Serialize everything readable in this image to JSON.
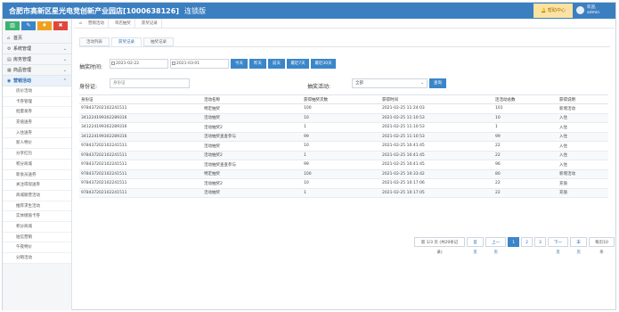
{
  "header": {
    "title": "合肥市高新区星光电竞创新产业园店[1000638126]",
    "version": "连锁版",
    "help_label": "帮助中心",
    "user_line1": "欢迎,",
    "user_line2": "admin"
  },
  "sidebar": {
    "tools": [
      {
        "icon": "bar-chart-icon",
        "glyph": "▥",
        "color": "#3cb371"
      },
      {
        "icon": "edit-icon",
        "glyph": "✎",
        "color": "#3b86c9"
      },
      {
        "icon": "shirt-icon",
        "glyph": "♦",
        "color": "#f0a020"
      },
      {
        "icon": "settings-icon",
        "glyph": "✖",
        "color": "#e0463c"
      }
    ],
    "sections": [
      {
        "label": "首页",
        "icon": "home-icon",
        "glyph": "⌂"
      },
      {
        "label": "系统管理",
        "icon": "gear-icon",
        "glyph": "⚙"
      },
      {
        "label": "房务管理",
        "icon": "bed-icon",
        "glyph": "▤"
      },
      {
        "label": "商品管理",
        "icon": "box-icon",
        "glyph": "▦"
      },
      {
        "label": "营销活动",
        "icon": "marketing-icon",
        "glyph": "◉"
      }
    ],
    "sub_items": [
      "房价活动",
      "卡券管理",
      "批量发券",
      "充值送券",
      "入住送券",
      "新人特价",
      "分享红包",
      "积分商城",
      "新会员送券",
      "关注得现送券",
      "商城联营活动",
      "推荐求生活动",
      "实体储值卡券",
      "积分商城",
      "短信营销",
      "午夜特价",
      "分销活动"
    ]
  },
  "breadcrumb": {
    "items": [
      "营销活动",
      "单店抽奖",
      "获奖记录"
    ]
  },
  "tabs": [
    "活动列表",
    "获奖记录",
    "抽奖记录"
  ],
  "filters": {
    "time_label": "抽奖时间:",
    "date_start": "2021-02-22",
    "date_end": "2021-03-01",
    "quick_buttons": [
      "今天",
      "昨天",
      "前天",
      "最近7天",
      "最近30天"
    ],
    "id_label": "身份证:",
    "id_placeholder": "身份证",
    "activity_label": "抽奖活动:",
    "activity_value": "全部",
    "search_label": "查询"
  },
  "table": {
    "headers": [
      "身份证",
      "活动名称",
      "获得抽奖次数",
      "获得时间",
      "连活动总数",
      "获得说明"
    ],
    "rows": [
      [
        "978437202102241511",
        "特定抽奖",
        "100",
        "2021-02-25 11:24:03",
        "101",
        "新增活动"
      ],
      [
        "341224199302289316",
        "活动抽奖",
        "10",
        "2021-02-25 11:10:53",
        "10",
        "入住"
      ],
      [
        "341224199302289316",
        "活动抽奖2",
        "1",
        "2021-02-25 11:10:53",
        "1",
        "入住"
      ],
      [
        "341224199302289316",
        "活动抽奖查查参与",
        "99",
        "2021-02-25 11:10:53",
        "99",
        "入住"
      ],
      [
        "978437202102241511",
        "活动抽奖",
        "10",
        "2021-02-25 10:41:45",
        "22",
        "入住"
      ],
      [
        "978437202102241511",
        "活动抽奖2",
        "1",
        "2021-02-25 10:41:45",
        "22",
        "入住"
      ],
      [
        "978437202102241511",
        "活动抽奖查查参与",
        "99",
        "2021-02-25 10:41:45",
        "96",
        "入住"
      ],
      [
        "978437202102241511",
        "特定抽奖",
        "100",
        "2021-02-25 10:33:42",
        "80",
        "新增活动"
      ],
      [
        "978437202102241511",
        "活动抽奖2",
        "10",
        "2021-02-25 10:17:06",
        "22",
        "充值"
      ],
      [
        "978437202102241511",
        "活动抽奖",
        "1",
        "2021-02-25 10:17:05",
        "22",
        "充值"
      ]
    ]
  },
  "pagination": {
    "info": "第 1/3 页 (共29条记录)",
    "first": "首页",
    "prev": "上一页",
    "pages": [
      "1",
      "2",
      "3"
    ],
    "next": "下一页",
    "last": "末页",
    "per_page": "每页10条"
  }
}
